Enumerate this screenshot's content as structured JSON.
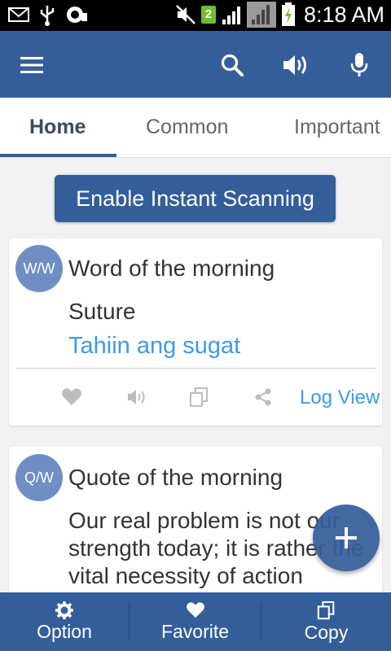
{
  "status_bar": {
    "time": "8:18 AM",
    "sim_badge": "2"
  },
  "app_bar": {
    "menu_icon": "menu-icon",
    "search_icon": "search-icon",
    "speaker_icon": "speaker-icon",
    "mic_icon": "mic-icon"
  },
  "tabs": [
    {
      "label": "Home",
      "active": true
    },
    {
      "label": "Common",
      "active": false
    },
    {
      "label": "Important",
      "active": false
    }
  ],
  "scan_button": {
    "label": "Enable Instant Scanning"
  },
  "word_card": {
    "avatar": "W/W",
    "title": "Word of the morning",
    "word": "Suture",
    "translation": "Tahiin ang sugat",
    "log_view": "Log View"
  },
  "quote_card": {
    "avatar": "Q/W",
    "title": "Quote of the morning",
    "lines": [
      "Our real problem is not our",
      "strength today; it is rather the",
      "vital necessity of action"
    ]
  },
  "bottom_nav": [
    {
      "label": "Option",
      "icon": "gear-icon"
    },
    {
      "label": "Favorite",
      "icon": "heart-icon"
    },
    {
      "label": "Copy",
      "icon": "copy-icon"
    }
  ],
  "colors": {
    "primary": "#345e9a",
    "accent": "#3d9be3",
    "avatar": "#6f8fc4"
  }
}
